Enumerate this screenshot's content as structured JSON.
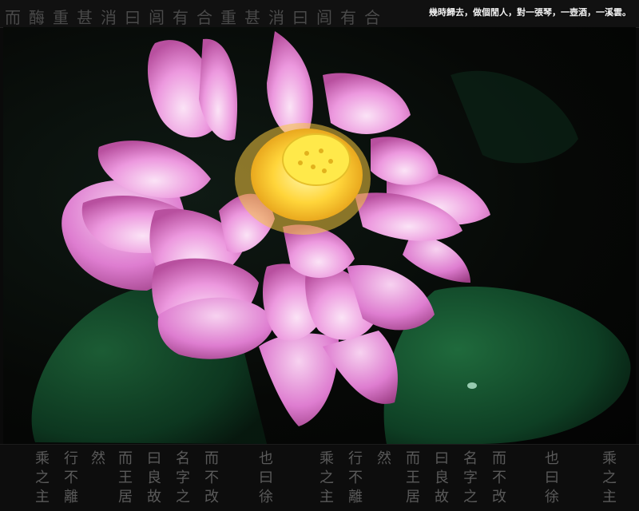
{
  "caption": "幾時歸去，做個閒人，對一張琴，一壺酒，一溪雲。",
  "top_calligraphy": "而酶重甚消曰闾有合重甚消曰闾有合",
  "bottom_calligraphy": [
    "乘之主",
    "行不離",
    "然",
    "而王居",
    "曰良故",
    "名字之",
    "而不改",
    "也曰徐",
    "乘之主",
    "行不離",
    "然",
    "而王居",
    "曰良故",
    "名字之",
    "而不改",
    "也曰徐",
    "乘之主"
  ],
  "colors": {
    "petal_light": "#f6c6ef",
    "petal_mid": "#e58ad8",
    "petal_dark": "#c25db5",
    "stamen": "#ffd53a",
    "receptacle": "#ffe94a",
    "leaf": "#0f4a2b",
    "leaf_dark": "#0a2e1b"
  },
  "photo_subject": "pink-lotus-flower"
}
